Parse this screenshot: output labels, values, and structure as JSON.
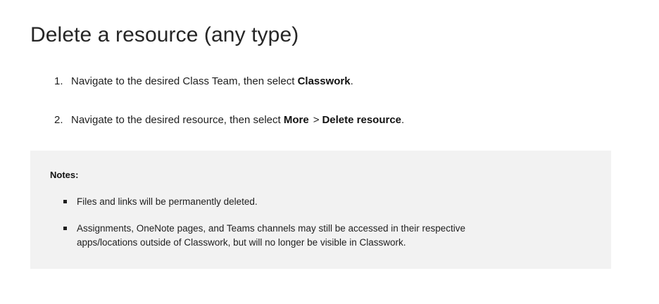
{
  "title": "Delete a resource (any type)",
  "steps": [
    {
      "number": "1.",
      "text_before": "Navigate to the desired Class Team, then select ",
      "bold_1": "Classwork",
      "text_after": "."
    },
    {
      "number": "2.",
      "text_before": "Navigate to the desired resource, then select ",
      "bold_1": "More",
      "separator": ">",
      "bold_2": "Delete resource",
      "text_after": "."
    }
  ],
  "notes": {
    "heading": "Notes:",
    "items": [
      "Files and links will be permanently deleted.",
      "Assignments, OneNote pages, and Teams channels may still be accessed in their respective apps/locations outside of Classwork, but will no longer be visible in Classwork."
    ]
  }
}
